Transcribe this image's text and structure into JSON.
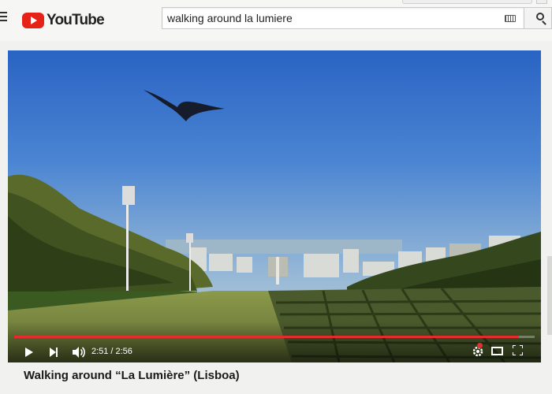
{
  "app": {
    "logo_text": "YouTube",
    "brand_color": "#e62117"
  },
  "search": {
    "query": "walking around la lumiere"
  },
  "player": {
    "current_time": "2:51",
    "duration": "2:56",
    "progress_fraction": 0.969,
    "progress_color": "#e52b2b"
  },
  "video": {
    "title": "Walking around “La Lumière” (Lisboa)"
  }
}
